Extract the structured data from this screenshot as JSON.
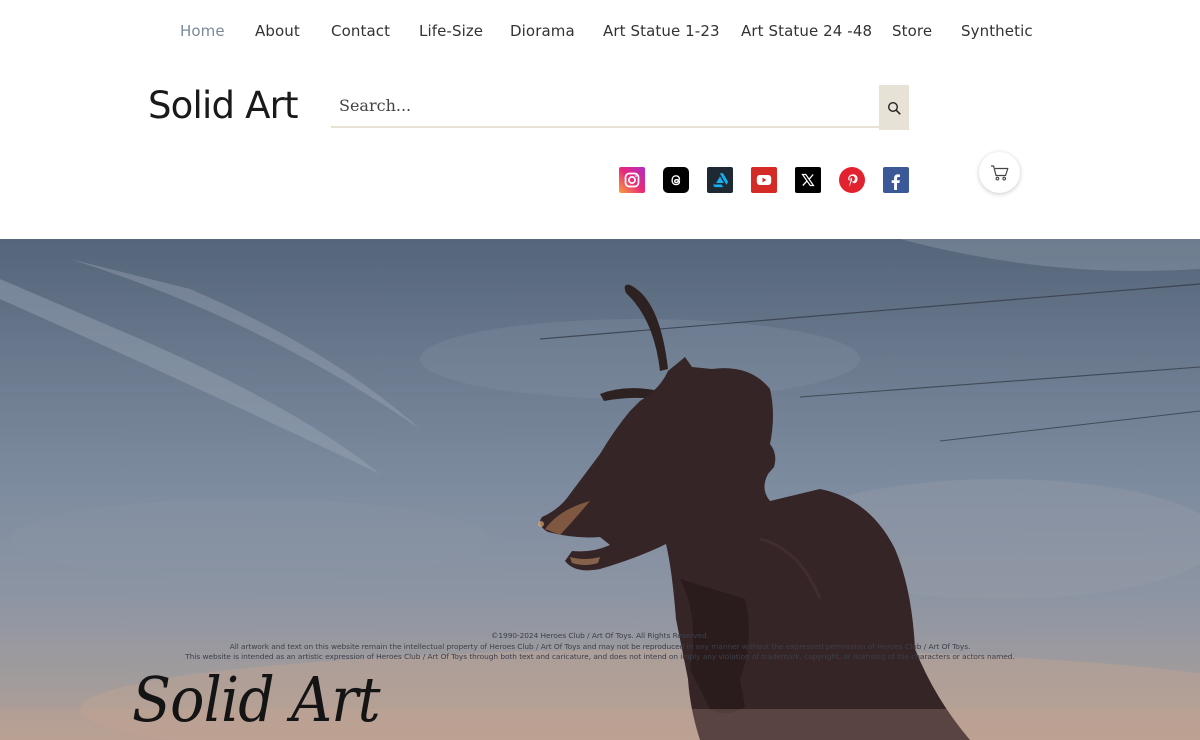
{
  "nav": {
    "items": [
      "Home",
      "About",
      "Contact",
      "Life-Size",
      "Diorama",
      "Art Statue 1-23",
      "Art Statue 24 -48",
      "Store",
      "Synthetic"
    ],
    "active": "Home"
  },
  "site": {
    "title": "Solid Art"
  },
  "search": {
    "placeholder": "Search..."
  },
  "social": [
    "instagram-icon",
    "threads-icon",
    "artstation-icon",
    "youtube-icon",
    "x-icon",
    "pinterest-icon",
    "facebook-icon"
  ],
  "footer": {
    "copyright": "©1990-2024 Heroes Club / Art Of Toys. All Rights Reserved.",
    "line2": "All artwork and text on this website remain the intellectual property of Heroes Club / Art Of Toys and may not be reproduced in any manner without the expressed permission of Heroes Club / Art Of Toys.",
    "line3": "This website is intended as an artistic expression of Heroes Club / Art Of Toys through both text and caricature, and does not intend on imply any violation of trademark, copyright, or licensing of the characters or actors named."
  },
  "hero": {
    "script_logo": "Solid Art"
  },
  "colors": {
    "accent": "#e8e2d6",
    "nav_active": "#7a8a9a",
    "text": "#333333"
  }
}
